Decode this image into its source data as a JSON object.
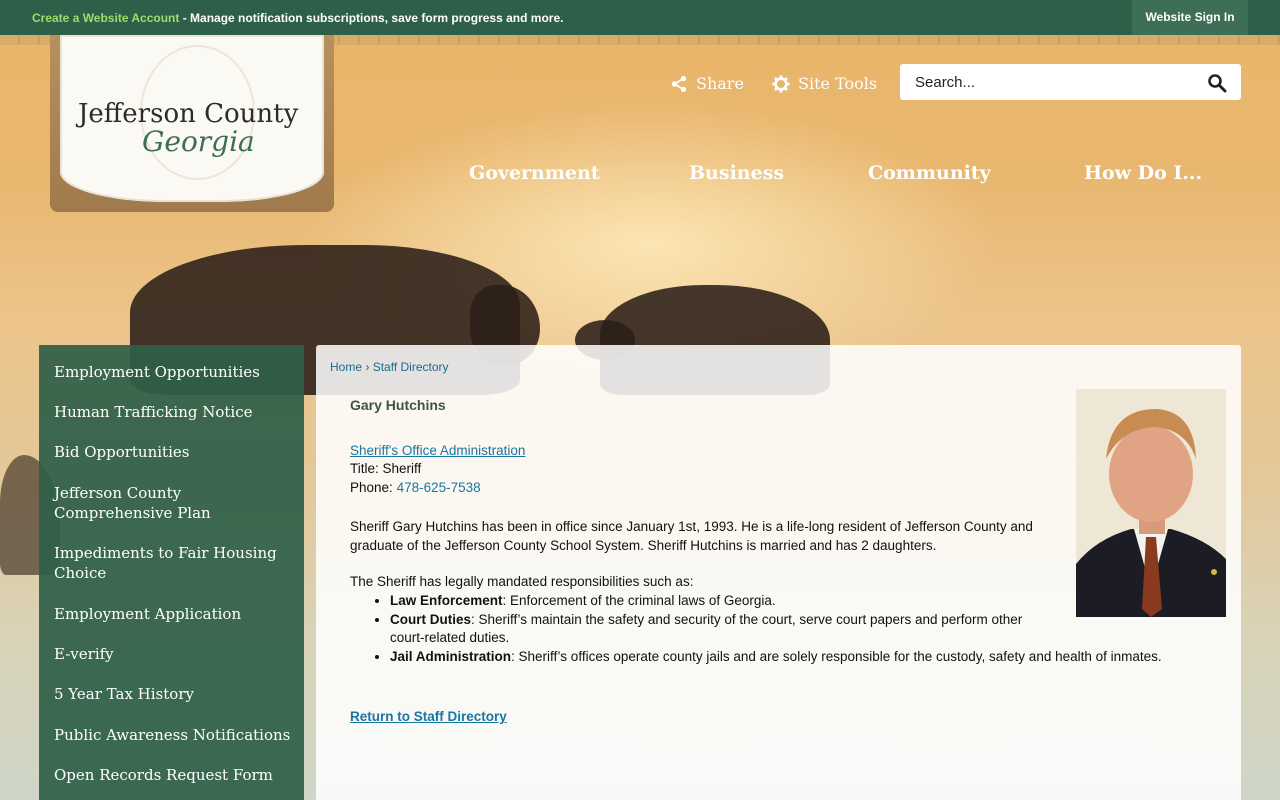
{
  "topbar": {
    "create_account": "Create a Website Account",
    "message": " - Manage notification subscriptions, save form progress and more.",
    "sign_in": "Website Sign In"
  },
  "logo": {
    "line1": "Jefferson County",
    "line2": "Georgia"
  },
  "tools": {
    "share": "Share",
    "site_tools": "Site Tools"
  },
  "search": {
    "placeholder": "Search..."
  },
  "nav": [
    "Government",
    "Business",
    "Community",
    "How Do I..."
  ],
  "sidebar": [
    "Employment Opportunities",
    "Human Trafficking Notice",
    "Bid Opportunities",
    "Jefferson County Comprehensive Plan",
    "Impediments to Fair Housing Choice",
    "Employment Application",
    "E-verify",
    "5 Year Tax History",
    "Public Awareness Notifications",
    "Open Records Request Form"
  ],
  "breadcrumb": {
    "home": "Home",
    "separator": "›",
    "current": "Staff Directory"
  },
  "staff": {
    "name": "Gary Hutchins",
    "department": "Sheriff's Office Administration",
    "title_label": "Title:",
    "title": "Sheriff",
    "phone_label": "Phone:",
    "phone": "478-625-7538",
    "bio": "Sheriff Gary Hutchins has been in office since January 1st, 1993. He is a life-long resident of Jefferson County and graduate of the Jefferson County School System. Sheriff Hutchins is married and has 2 daughters.",
    "resp_intro": "The Sheriff has legally mandated responsibilities such as:",
    "responsibilities": [
      {
        "term": "Law Enforcement",
        "desc": ": Enforcement of the criminal laws of Georgia."
      },
      {
        "term": "Court Duties",
        "desc": ": Sheriff’s maintain the safety and security of the court, serve court papers and perform other court-related duties."
      },
      {
        "term": "Jail Administration",
        "desc": ": Sheriff’s offices operate county jails and are solely responsible for the custody, safety and health of inmates."
      }
    ],
    "return_link": "Return to Staff Directory"
  },
  "colors": {
    "topbar": "#2e5f48",
    "sidebar": "#2f6048",
    "link": "#1a76a3",
    "accent_green": "#9ddc6d"
  }
}
